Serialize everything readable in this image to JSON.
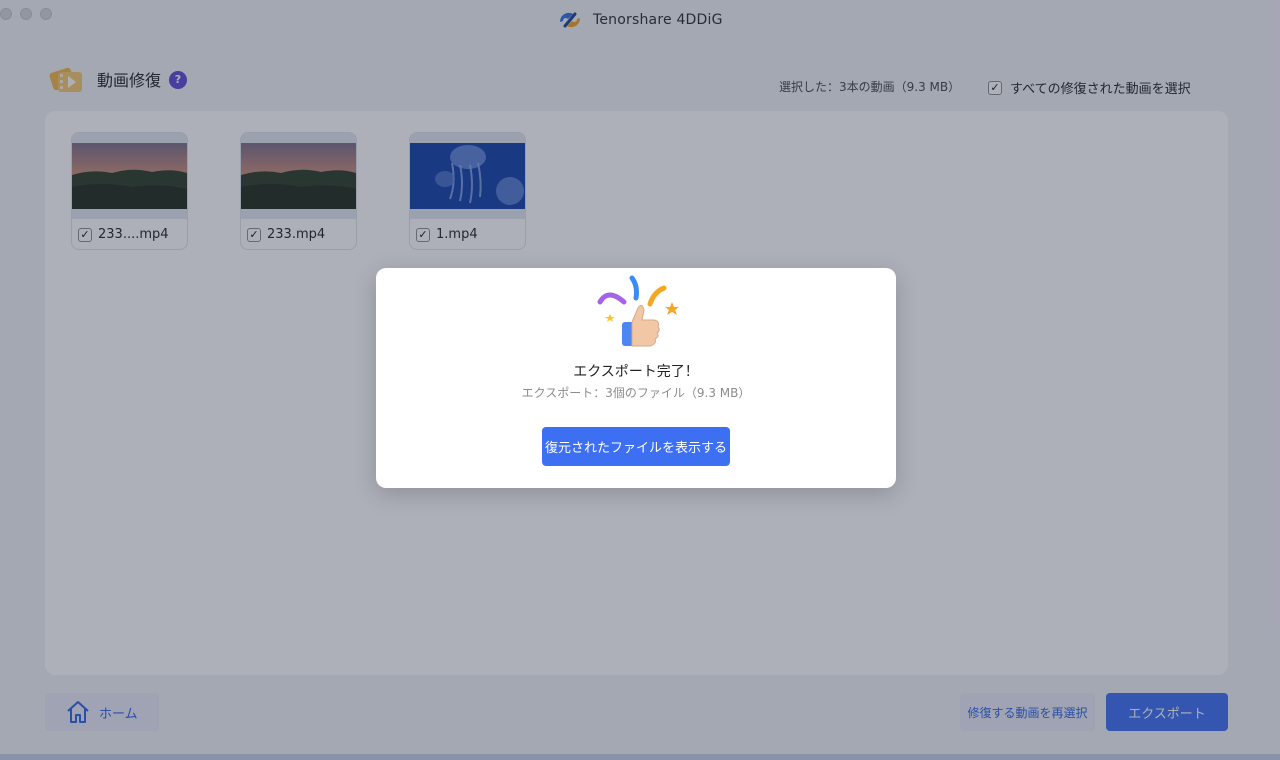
{
  "window": {
    "app_title": "Tenorshare 4DDiG",
    "logo_icon": "tenorshare-4ddig-logo-icon"
  },
  "header": {
    "title": "動画修復",
    "help_icon_glyph": "?",
    "selected_info": "選択した：3本の動画（9.3 MB）",
    "select_all_label": "すべての修復された動画を選択",
    "select_all_checked": true
  },
  "files": [
    {
      "name": "233....mp4",
      "checked": true,
      "thumbnail": "sunset-forest"
    },
    {
      "name": "233.mp4",
      "checked": true,
      "thumbnail": "sunset-forest"
    },
    {
      "name": "1.mp4",
      "checked": true,
      "thumbnail": "jellyfish"
    }
  ],
  "footer": {
    "home_label": "ホーム",
    "reselect_label": "修復する動画を再選択",
    "export_label": "エクスポート"
  },
  "modal": {
    "title": "エクスポート完了！",
    "subtitle": "エクスポート：3個のファイル（9.3 MB）",
    "button_label": "復元されたファイルを表示する",
    "illustration": "thumbs-up-celebration-icon"
  },
  "colors": {
    "accent": "#3d6ff2",
    "secondary_button_bg": "#e8ebf6",
    "secondary_button_text": "#2d63e2",
    "help_badge": "#5a49d6"
  },
  "checkmark_glyph": "✓"
}
